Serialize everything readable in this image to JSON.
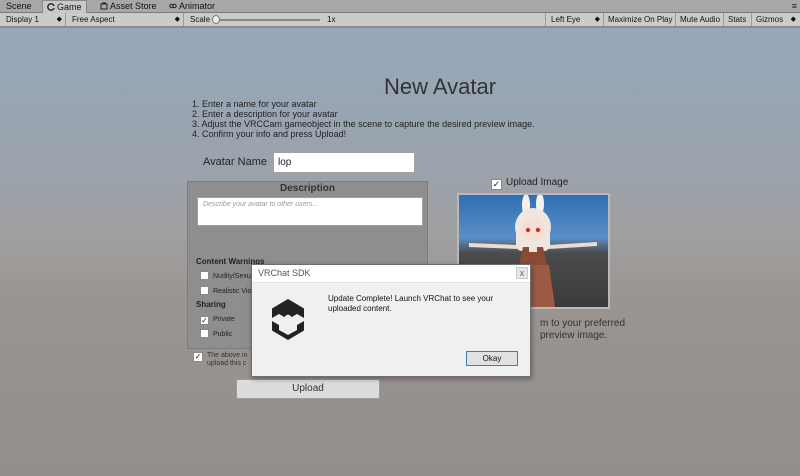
{
  "tabs": [
    {
      "label": "Scene",
      "icon": "scene-icon"
    },
    {
      "label": "Game",
      "icon": "game-icon"
    },
    {
      "label": "Asset Store",
      "icon": "asset-store-icon"
    },
    {
      "label": "Animator",
      "icon": "animator-icon"
    }
  ],
  "toolbar": {
    "display": "Display 1",
    "aspect": "Free Aspect",
    "scale_label": "Scale",
    "scale_value": "1x",
    "eye": "Left Eye",
    "maximize": "Maximize On Play",
    "mute": "Mute Audio",
    "stats": "Stats",
    "gizmos": "Gizmos"
  },
  "form": {
    "title": "New Avatar",
    "steps": [
      "1. Enter a name for your avatar",
      "2. Enter a description for your avatar",
      "3. Adjust the VRCCam gameobject in the scene to capture the desired preview image.",
      "4. Confirm your info and press Upload!"
    ],
    "name_label": "Avatar Name",
    "name_value": "lop",
    "description_heading": "Description",
    "description_placeholder": "Describe your avatar to other users...",
    "content_warnings_heading": "Content Warnings",
    "warnings": [
      {
        "label": "Nudity/Sexu",
        "checked": false
      },
      {
        "label": "Realistic Vio",
        "checked": false
      }
    ],
    "sharing_heading": "Sharing",
    "sharing": [
      {
        "label": "Private",
        "checked": true
      },
      {
        "label": "Public",
        "checked": false
      }
    ],
    "agree_text_1": "The above in",
    "agree_text_2": "upload this c",
    "agree_checked": true,
    "upload_button": "Upload",
    "upload_image_label": "Upload Image",
    "upload_image_checked": true,
    "preview_caption_1": "m to your preferred",
    "preview_caption_2": "preview image."
  },
  "dialog": {
    "title": "VRChat SDK",
    "close": "x",
    "message": "Update Complete! Launch VRChat to see your uploaded content.",
    "ok_button": "Okay",
    "logo": "unity-logo-icon"
  }
}
